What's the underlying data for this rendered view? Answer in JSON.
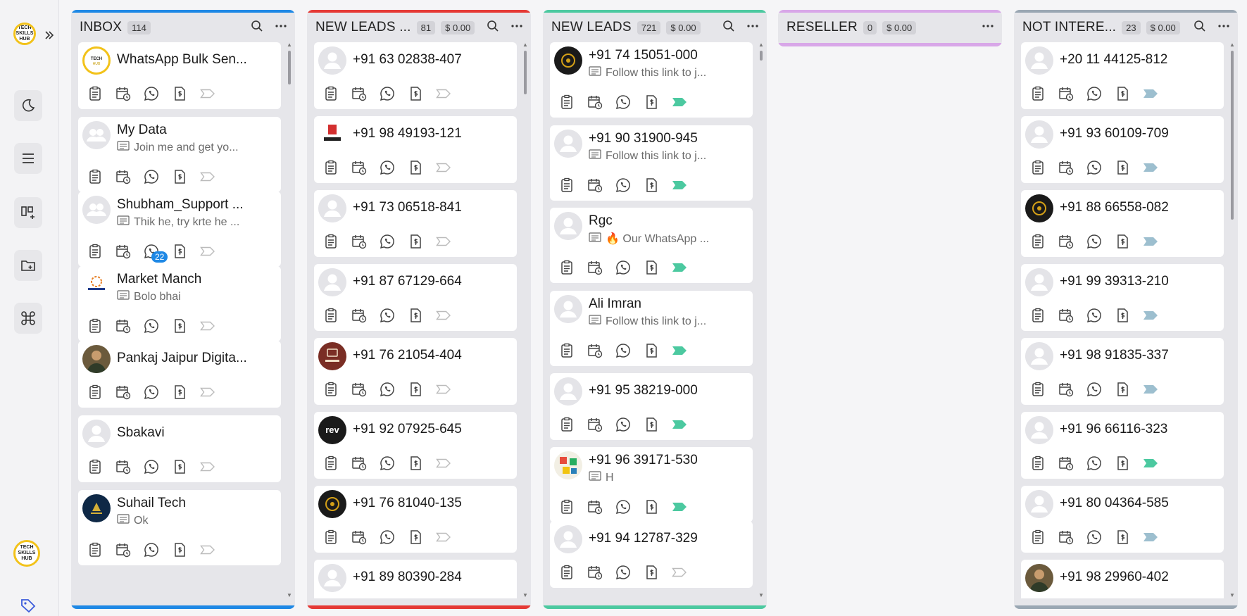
{
  "columns": [
    {
      "title": "INBOX",
      "count": "114",
      "amount": "",
      "accent": "#1e88e5",
      "has_search": true,
      "tag_color": "#c8c8cc",
      "cards": [
        {
          "name": "WhatsApp Bulk Sen...",
          "msg": "",
          "avatar": "logo"
        },
        {
          "name": "My Data",
          "msg": "Join me and get yo...",
          "avatar": "group"
        },
        {
          "name": "Shubham_Support ...",
          "msg": "Thik he, try krte he ...",
          "avatar": "group",
          "badge": "22"
        },
        {
          "name": "Market Manch",
          "msg": "Bolo bhai",
          "avatar": "market"
        },
        {
          "name": "Pankaj Jaipur Digita...",
          "msg": "",
          "avatar": "photo"
        },
        {
          "name": "Sbakavi",
          "msg": "",
          "avatar": "person"
        },
        {
          "name": "Suhail Tech",
          "msg": "Ok",
          "avatar": "suhail"
        }
      ]
    },
    {
      "title": "NEW LEADS ...",
      "count": "81",
      "amount": "$ 0.00",
      "accent": "#e53935",
      "has_search": true,
      "tag_color": "#c8c8cc",
      "cards": [
        {
          "name": "+91 63 02838-407",
          "msg": "",
          "avatar": "person"
        },
        {
          "name": "+91 98 49193-121",
          "msg": "",
          "avatar": "pixels"
        },
        {
          "name": "+91 73 06518-841",
          "msg": "",
          "avatar": "person"
        },
        {
          "name": "+91 87 67129-664",
          "msg": "",
          "avatar": "person"
        },
        {
          "name": "+91 76 21054-404",
          "msg": "",
          "avatar": "royal"
        },
        {
          "name": "+91 92 07925-645",
          "msg": "",
          "avatar": "rev"
        },
        {
          "name": "+91 76 81040-135",
          "msg": "",
          "avatar": "darkphoto"
        },
        {
          "name": "+91 89 80390-284",
          "msg": "",
          "avatar": "person"
        }
      ]
    },
    {
      "title": "NEW LEADS",
      "count": "721",
      "amount": "$ 0.00",
      "accent": "#4cc9a0",
      "has_search": true,
      "tag_color": "#4cc9a0",
      "cards": [
        {
          "name": "+91 74 15051-000",
          "msg": "Follow this link to j...",
          "avatar": "darkphoto"
        },
        {
          "name": "+91 90 31900-945",
          "msg": "Follow this link to j...",
          "avatar": "person"
        },
        {
          "name": "Rgc",
          "msg": "🔥 Our WhatsApp ...",
          "avatar": "person"
        },
        {
          "name": "Ali Imran",
          "msg": "Follow this link to j...",
          "avatar": "person"
        },
        {
          "name": "+91 95 38219-000",
          "msg": "",
          "avatar": "person"
        },
        {
          "name": "+91 96 39171-530",
          "msg": "H",
          "avatar": "colorful"
        },
        {
          "name": "+91 94 12787-329",
          "msg": "",
          "avatar": "person",
          "tag_outline": true
        }
      ]
    },
    {
      "title": "RESELLER",
      "count": "0",
      "amount": "$ 0.00",
      "accent": "#d8a7e8",
      "has_search": false,
      "tag_color": "#c8c8cc",
      "cards": []
    },
    {
      "title": "NOT INTERE...",
      "count": "23",
      "amount": "$ 0.00",
      "accent": "#9aa7b3",
      "has_search": true,
      "tag_color": "#9dbfcf",
      "cards": [
        {
          "name": "+20 11 44125-812",
          "msg": "",
          "avatar": "person"
        },
        {
          "name": "+91 93 60109-709",
          "msg": "",
          "avatar": "person"
        },
        {
          "name": "+91 88 66558-082",
          "msg": "",
          "avatar": "darkphoto"
        },
        {
          "name": "+91 99 39313-210",
          "msg": "",
          "avatar": "person"
        },
        {
          "name": "+91 98 91835-337",
          "msg": "",
          "avatar": "person"
        },
        {
          "name": "+91 96 66116-323",
          "msg": "",
          "avatar": "person",
          "tag_green": true
        },
        {
          "name": "+91 80 04364-585",
          "msg": "",
          "avatar": "person"
        },
        {
          "name": "+91 98 29960-402",
          "msg": "",
          "avatar": "photo"
        }
      ]
    }
  ],
  "rail": {
    "logo_text": "TECH SKILLS HUB"
  }
}
